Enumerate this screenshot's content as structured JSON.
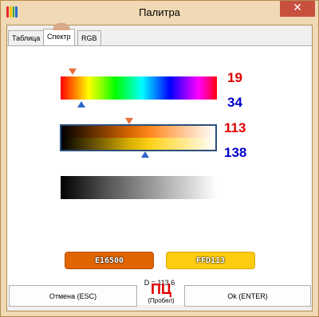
{
  "window": {
    "title": "Палитра",
    "close_glyph": "✕",
    "icon": "palette-icon"
  },
  "tabs": [
    {
      "label": "Таблица",
      "active": false
    },
    {
      "label": "Спектр",
      "active": true
    },
    {
      "label": "RGB",
      "active": false
    }
  ],
  "spectrum": {
    "hue_top": "19",
    "hue_bottom": "34"
  },
  "shades": {
    "shade_top": "113",
    "shade_bottom": "138"
  },
  "colors": {
    "first_code": "E16500",
    "second_code": "FFD113",
    "first_hex": "#e16500",
    "second_hex": "#ffcc10"
  },
  "distance_text": "D = 113.6",
  "buttons": {
    "cancel_label": "Отмена (ESC)",
    "ok_label": "Ok (ENTER)",
    "center_big": "ПЦ",
    "center_small": "(Пробел)"
  }
}
